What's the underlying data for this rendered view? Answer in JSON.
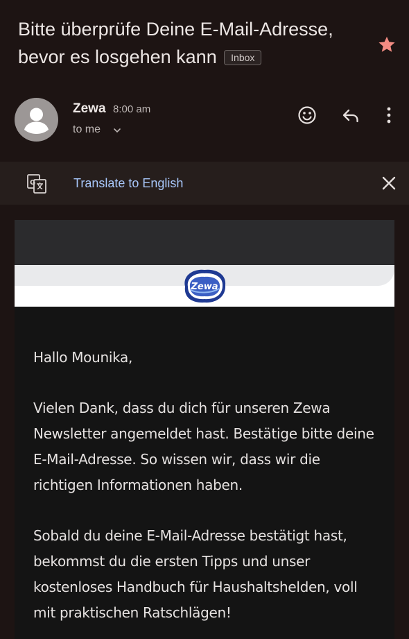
{
  "email": {
    "subject": "Bitte überprüfe Deine E-Mail-Adresse, bevor es losgehen kann",
    "label": "Inbox",
    "starred": true,
    "sender": "Zewa",
    "time": "8:00 am",
    "recipient": "to me"
  },
  "translate_bar": {
    "link": "Translate to English"
  },
  "content": {
    "logo_text": "Zewa",
    "greeting": "Hallo Mounika,",
    "paragraph1": "Vielen Dank, dass du dich für unseren Zewa Newsletter angemeldet hast. Bestätige bitte deine E-Mail-Adresse. So wissen wir, dass wir die richtigen Informationen haben.",
    "paragraph2": "Sobald du deine E-Mail-Adresse bestätigt hast, bekommst du die ersten Tipps und unser kostenloses Handbuch für Haushaltshelden, voll mit praktischen Ratschlägen!"
  },
  "colors": {
    "background": "#1d1413",
    "star": "#f28b82",
    "link": "#a8c7fa",
    "brand_blue": "#1f3a93"
  },
  "icons": [
    "star-icon",
    "avatar-person-icon",
    "chevron-down-icon",
    "emoji-icon",
    "reply-icon",
    "more-vert-icon",
    "translate-icon",
    "close-icon"
  ]
}
